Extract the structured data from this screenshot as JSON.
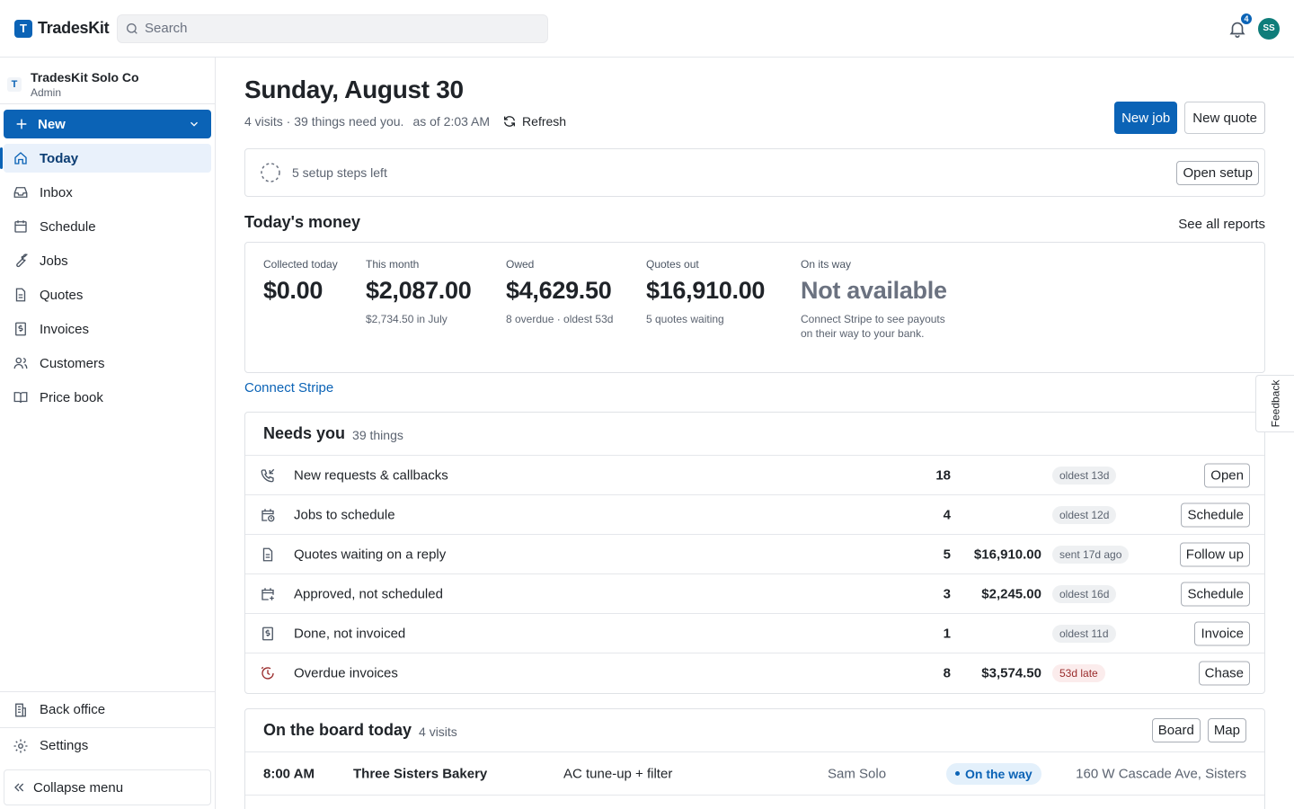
{
  "app": {
    "logo_letter": "T",
    "name": "TradesKit"
  },
  "search": {
    "placeholder": "Search"
  },
  "topbar": {
    "notifications_count": "4",
    "avatar_initials": "SS"
  },
  "org": {
    "letter": "T",
    "name": "TradesKit Solo Co",
    "role": "Admin"
  },
  "sidebar": {
    "new_label": "New",
    "items": [
      {
        "label": "Today",
        "icon": "home-icon",
        "active": true
      },
      {
        "label": "Inbox",
        "icon": "inbox-icon"
      },
      {
        "label": "Schedule",
        "icon": "calendar-icon"
      },
      {
        "label": "Jobs",
        "icon": "wrench-icon"
      },
      {
        "label": "Quotes",
        "icon": "document-icon"
      },
      {
        "label": "Invoices",
        "icon": "dollar-document-icon"
      },
      {
        "label": "Customers",
        "icon": "users-icon"
      },
      {
        "label": "Price book",
        "icon": "book-icon"
      }
    ],
    "back_office": "Back office",
    "settings": "Settings",
    "collapse": "Collapse menu"
  },
  "header": {
    "title": "Sunday, August 30",
    "summary": "4 visits · 39 things need you.",
    "as_of": "as of 2:03 AM",
    "refresh": "Refresh",
    "new_job": "New job",
    "new_quote": "New quote"
  },
  "setup": {
    "text": "5 setup steps left",
    "button": "Open setup"
  },
  "money": {
    "title": "Today's money",
    "reports_link": "See all reports",
    "stats": [
      {
        "label": "Collected today",
        "value": "$0.00",
        "sub": ""
      },
      {
        "label": "This month",
        "value": "$2,087.00",
        "sub": "$2,734.50 in July"
      },
      {
        "label": "Owed",
        "value": "$4,629.50",
        "sub": "8 overdue · oldest 53d"
      },
      {
        "label": "Quotes out",
        "value": "$16,910.00",
        "sub": "5 quotes waiting"
      },
      {
        "label": "On its way",
        "value": "Not available",
        "sub": "Connect Stripe to see payouts on their way to your bank."
      }
    ],
    "connect_stripe": "Connect Stripe"
  },
  "needs": {
    "title": "Needs you",
    "count": "39 things",
    "rows": [
      {
        "icon": "phone-incoming-icon",
        "label": "New requests & callbacks",
        "count": "18",
        "amount": "",
        "pill": "oldest 13d",
        "action": "Open"
      },
      {
        "icon": "calendar-clock-icon",
        "label": "Jobs to schedule",
        "count": "4",
        "amount": "",
        "pill": "oldest 12d",
        "action": "Schedule"
      },
      {
        "icon": "document-icon",
        "label": "Quotes waiting on a reply",
        "count": "5",
        "amount": "$16,910.00",
        "pill": "sent 17d ago",
        "action": "Follow up"
      },
      {
        "icon": "calendar-plus-icon",
        "label": "Approved, not scheduled",
        "count": "3",
        "amount": "$2,245.00",
        "pill": "oldest 16d",
        "action": "Schedule"
      },
      {
        "icon": "dollar-document-icon",
        "label": "Done, not invoiced",
        "count": "1",
        "amount": "",
        "pill": "oldest 11d",
        "action": "Invoice"
      },
      {
        "icon": "clock-alert-icon",
        "label": "Overdue invoices",
        "count": "8",
        "amount": "$3,574.50",
        "pill": "53d late",
        "action": "Chase"
      }
    ]
  },
  "board": {
    "title": "On the board today",
    "count": "4 visits",
    "board_btn": "Board",
    "map_btn": "Map",
    "rows": [
      {
        "time": "8:00 AM",
        "customer": "Three Sisters Bakery",
        "job": "AC tune-up + filter",
        "tech": "Sam Solo",
        "status": "On the way",
        "address": "160 W Cascade Ave, Sisters"
      }
    ]
  },
  "feedback": "Feedback",
  "colors": {
    "brand": "#0b63b6",
    "avatar": "#0f7d7a",
    "late": "#9a2c2c"
  }
}
